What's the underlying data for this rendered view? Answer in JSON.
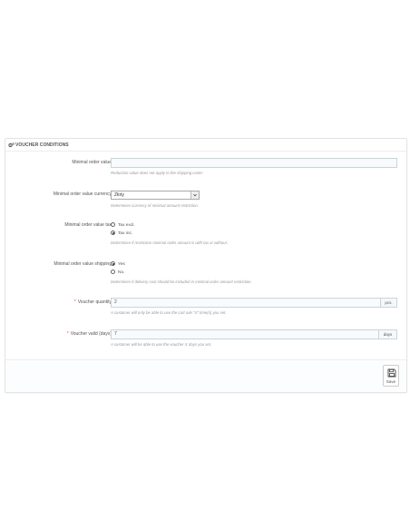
{
  "panel": {
    "title": "VOUCHER CONDITIONS",
    "icon": "cogs-icon"
  },
  "fields": {
    "min_order_value": {
      "label": "Minimal order value",
      "value": "",
      "help": "Reduction value does not apply to the shipping costs!"
    },
    "min_order_currency": {
      "label": "Minimal order value currency",
      "selected": "Złoty",
      "help": "Determines currency of minimal amount restriction."
    },
    "min_order_tax": {
      "label": "Minimal order value tax",
      "options": [
        "Tax excl.",
        "Tax inc."
      ],
      "selected_index": 1,
      "help": "Determines if restriction minimal order amount is with tax or without."
    },
    "min_order_shipping": {
      "label": "Minimal order value shipping",
      "options": [
        "Yes",
        "No."
      ],
      "selected_index": 0,
      "help": "Determines if delivery cost should be included in minimal order amount restriction."
    },
    "voucher_quantity": {
      "required": "*",
      "label": "Voucher quantity",
      "value": "2",
      "unit": "pcs.",
      "help": "A customer will only be able to use the cart rule \"X\" time(s) you set."
    },
    "voucher_valid": {
      "required": "*",
      "label": "Voucher valid (days)",
      "value": "7",
      "unit": "days",
      "help": "A customer will be able to use the voucher X days you set."
    }
  },
  "footer": {
    "save_label": "Save",
    "save_icon": "floppy-disk-icon"
  }
}
